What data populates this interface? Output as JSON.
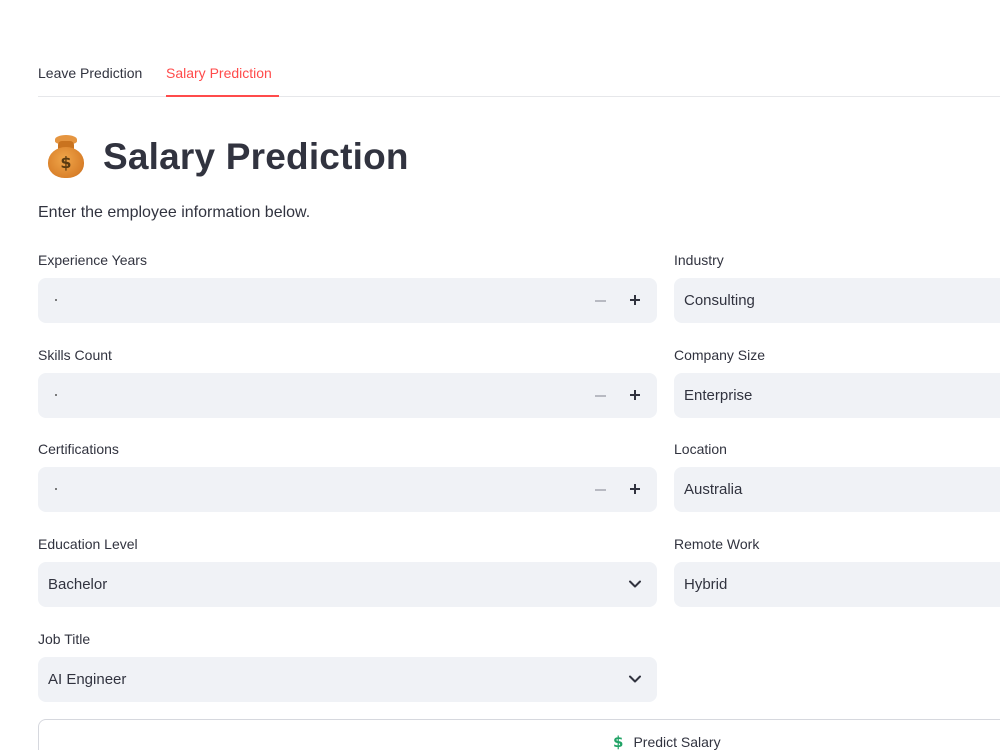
{
  "tabs": [
    {
      "label": "Leave Prediction",
      "active": false
    },
    {
      "label": "Salary Prediction",
      "active": true
    }
  ],
  "header": {
    "icon": "money-bag-icon",
    "title": "Salary Prediction",
    "intro": "Enter the employee information below."
  },
  "form": {
    "experience_years": {
      "label": "Experience Years",
      "value": ""
    },
    "skills_count": {
      "label": "Skills Count",
      "value": ""
    },
    "certifications": {
      "label": "Certifications",
      "value": ""
    },
    "education_level": {
      "label": "Education Level",
      "value": "Bachelor"
    },
    "job_title": {
      "label": "Job Title",
      "value": "AI Engineer"
    },
    "industry": {
      "label": "Industry",
      "value": "Consulting"
    },
    "company_size": {
      "label": "Company Size",
      "value": "Enterprise"
    },
    "location": {
      "label": "Location",
      "value": "Australia"
    },
    "remote_work": {
      "label": "Remote Work",
      "value": "Hybrid"
    }
  },
  "predict_button": {
    "label": "Predict Salary",
    "icon": "dollar-icon"
  },
  "colors": {
    "accent": "#ff4b4b",
    "input_bg": "#f0f2f6",
    "dollar": "#21a366"
  }
}
